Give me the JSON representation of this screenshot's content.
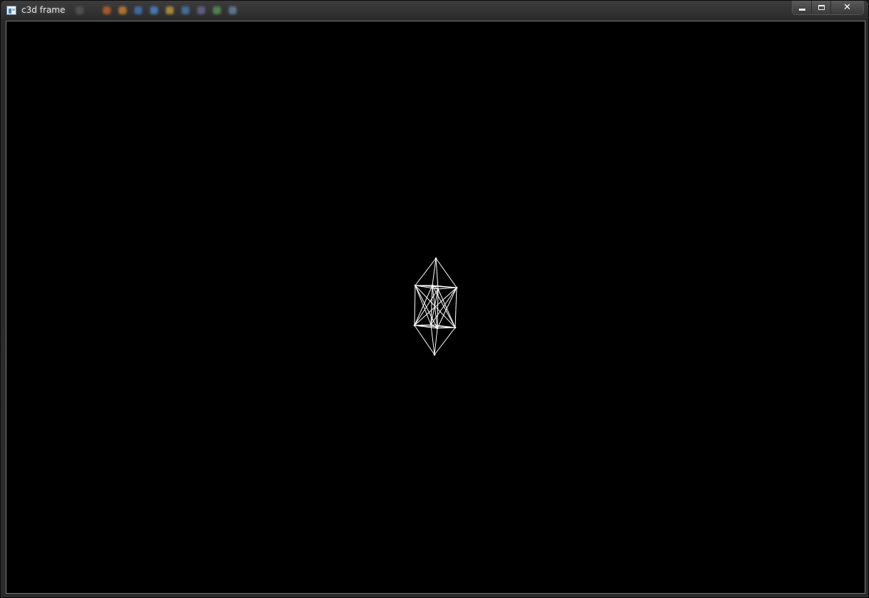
{
  "window": {
    "title": "c3d frame",
    "app_icon": "app-window-icon"
  },
  "caption_buttons": {
    "minimize_icon": "minimize-icon",
    "maximize_icon": "maximize-icon",
    "close_label": "✕"
  },
  "viewport": {
    "background_color": "#000000",
    "line_color": "#ffffff",
    "object": {
      "name": "wireframe-solid",
      "vertex_count": 10
    }
  }
}
